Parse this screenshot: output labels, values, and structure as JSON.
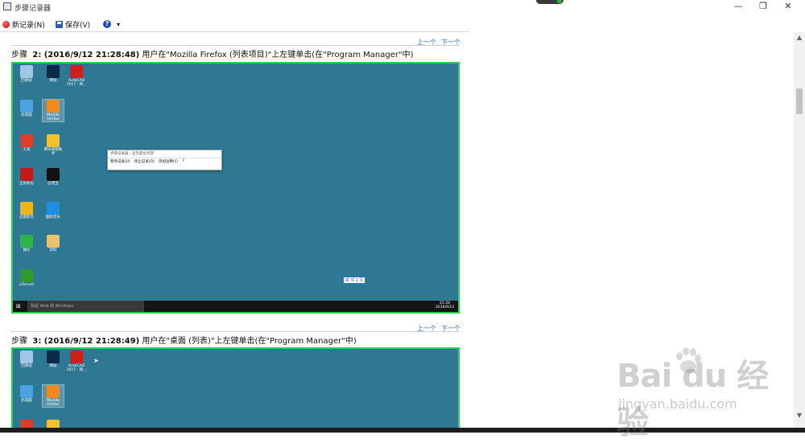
{
  "window": {
    "title": "步骤记录器",
    "min_glyph": "—",
    "max_glyph": "❐",
    "close_glyph": "✕"
  },
  "toolbar": {
    "new_record_label": "新记录(N)",
    "save_label": "保存(V)",
    "help_glyph": "?",
    "help_dropdown_glyph": "▾"
  },
  "nav": {
    "prev": "上一个",
    "next": "下一个"
  },
  "steps": [
    {
      "prefix": "步骤",
      "bold": "2: (2016/9/12 21:28:48)",
      "text": " 用户在\"Mozilla Firefox (列表项目)\"上左键单击(在\"Program Manager\"中)"
    },
    {
      "prefix": "步骤",
      "bold": "3: (2016/9/12 21:28:49)",
      "text": " 用户在\"桌面 (列表)\"上左键单击(在\"Program Manager\"中)"
    }
  ],
  "screenshot": {
    "desktop_icons": [
      {
        "label": "回收站",
        "color": "#9fc7e8",
        "icon": "recycle-bin-icon"
      },
      {
        "label": "网站",
        "color": "#0b2a4a",
        "icon": "photoshop-icon"
      },
      {
        "label": "AutoCAD 2017 - 简...",
        "color": "#d01f1f",
        "icon": "autocad-icon"
      },
      {
        "label": "此电脑",
        "color": "#4aa3e0",
        "icon": "computer-icon"
      },
      {
        "label": "Mozilla Firefox",
        "color": "#f08a1c",
        "icon": "firefox-icon"
      },
      {
        "label": "工具",
        "color": "#e03c2c",
        "icon": "tool-icon"
      },
      {
        "label": "腾讯视频助手",
        "color": "#f2c12e",
        "icon": "tencent-icon"
      },
      {
        "label": "全民射击",
        "color": "#c21a1a",
        "icon": "game-icon"
      },
      {
        "label": "应用宝",
        "color": "#111111",
        "icon": "qq-icon"
      },
      {
        "label": "迅雷影音",
        "color": "#f1b21a",
        "icon": "thunder-icon"
      },
      {
        "label": "酷狗音乐",
        "color": "#1e8fe0",
        "icon": "kugou-icon"
      },
      {
        "label": "微信",
        "color": "#2db34a",
        "icon": "wechat-icon"
      },
      {
        "label": "资料",
        "color": "#e8c36a",
        "icon": "folder-icon"
      },
      {
        "label": "uTorrent",
        "color": "#2c9a2c",
        "icon": "utorrent-icon"
      }
    ],
    "popup_title": "步骤记录器 - 显示部分步骤",
    "popup_buttons": [
      "暂停记录(U)",
      "停止记录(O)",
      "添加注释(C)"
    ],
    "popup_help": "?",
    "ime_text": "拼 中 ∮ 写",
    "taskbar_search": "我是 Web 和 Windows",
    "taskbar_time": "21:28",
    "taskbar_date": "2016/9/12"
  },
  "scroll": {
    "up": "▲",
    "down": "▼"
  },
  "watermark": {
    "logo": "Bai du 经验",
    "url": "jingyan.baidu.com"
  }
}
